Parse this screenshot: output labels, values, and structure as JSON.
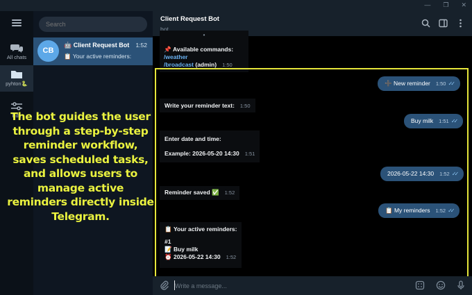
{
  "window": {
    "minimize": "—",
    "restore": "❐",
    "close": "✕"
  },
  "rail": {
    "all_chats": "All chats",
    "folder_label": "pyhton",
    "folder_emoji": "🐍",
    "edit_label": "Edit"
  },
  "search": {
    "placeholder": "Search"
  },
  "chat_list": {
    "items": [
      {
        "initials": "CB",
        "name": "Client Request Bot",
        "name_icon": "🤖",
        "time": "1:52",
        "preview": "Your active reminders:",
        "preview_icon": "📋",
        "avatar_color": "#5da8e8"
      }
    ]
  },
  "header": {
    "title": "Client Request Bot",
    "subtitle": "bot"
  },
  "messages": {
    "m0": {
      "top_text": "•",
      "icon": "📌",
      "title": "Available commands:",
      "cmd1": "/weather",
      "cmd2": "/broadcast",
      "suffix": " (admin)",
      "time": "1:50"
    },
    "m1": {
      "text": "New reminder",
      "icon": "➕",
      "time": "1:50"
    },
    "m2": {
      "text": "Write your reminder text:",
      "time": "1:50"
    },
    "m3": {
      "text": "Buy milk",
      "time": "1:51"
    },
    "m4": {
      "line1": "Enter date and time:",
      "line2": "Example: 2026-05-20 14:30",
      "time": "1:51"
    },
    "m5": {
      "text": "2026-05-22 14:30",
      "time": "1:52"
    },
    "m6": {
      "text": "Reminder saved",
      "icon": "✅",
      "time": "1:52"
    },
    "m7": {
      "text": "My reminders",
      "icon": "📋",
      "time": "1:52"
    },
    "m8": {
      "icon": "📋",
      "title": "Your active reminders:",
      "index": "#1",
      "item_icon": "📝",
      "item": "Buy milk",
      "when_icon": "⏰",
      "when": "2026-05-22 14:30",
      "time": "1:52"
    }
  },
  "composer": {
    "placeholder": "Write a message..."
  },
  "overlay": {
    "text": "The bot guides the user through a step-by-step reminder workflow, saves scheduled tasks, and allows users to manage active reminders directly inside Telegram."
  },
  "colors": {
    "accent": "#2b5278",
    "highlight": "#e6e63a",
    "overlay_text": "#eaf23f",
    "link": "#6ab2f2"
  }
}
